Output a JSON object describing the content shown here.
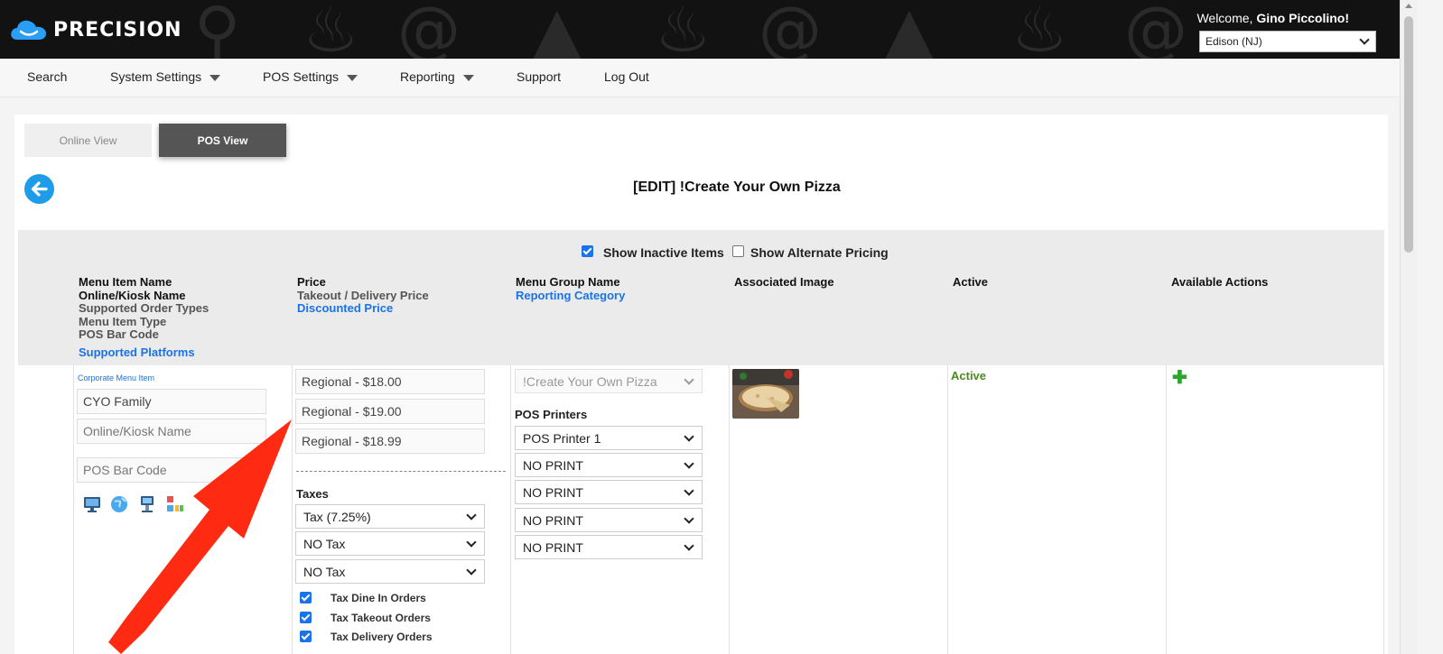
{
  "header": {
    "brand": "PRECISION",
    "welcome_prefix": "Welcome, ",
    "user_name": "Gino Piccolino!",
    "location": "Edison (NJ)"
  },
  "nav": {
    "search": "Search",
    "system_settings": "System Settings",
    "pos_settings": "POS Settings",
    "reporting": "Reporting",
    "support": "Support",
    "logout": "Log Out"
  },
  "tabs": {
    "online": "Online View",
    "pos": "POS View"
  },
  "page_title": "[EDIT] !Create Your Own Pizza",
  "filters": {
    "show_inactive": {
      "label": "Show Inactive Items",
      "checked": true
    },
    "show_alternate": {
      "label": "Show Alternate Pricing",
      "checked": false
    }
  },
  "columns": {
    "name": {
      "line1": "Menu Item Name",
      "line2": "Online/Kiosk Name",
      "line3": "Supported Order Types",
      "line4": "Menu Item Type",
      "line5": "POS Bar Code",
      "line6": "Supported Platforms"
    },
    "price": {
      "line1": "Price",
      "line2": "Takeout / Delivery Price",
      "line3": "Discounted Price"
    },
    "group": {
      "line1": "Menu Group Name",
      "line2": "Reporting Category"
    },
    "image": "Associated Image",
    "active": "Active",
    "actions": "Available Actions"
  },
  "row": {
    "corporate_link": "Corporate Menu Item",
    "name_value": "CYO Family",
    "online_name_placeholder": "Online/Kiosk Name",
    "barcode_placeholder": "POS Bar Code",
    "platform_icons": [
      "desktop-icon",
      "globe-icon",
      "kiosk-icon",
      "apps-icon"
    ],
    "prices": [
      "Regional - $18.00",
      "Regional - $19.00",
      "Regional - $18.99"
    ],
    "taxes_label": "Taxes",
    "taxes": [
      "Tax (7.25%)",
      "NO Tax",
      "NO Tax"
    ],
    "tax_options": [
      {
        "label": "Tax Dine In Orders",
        "checked": true
      },
      {
        "label": "Tax Takeout Orders",
        "checked": true
      },
      {
        "label": "Tax Delivery Orders",
        "checked": true
      }
    ],
    "menu_group": "!Create Your Own Pizza",
    "printers_label": "POS Printers",
    "printers": [
      "POS Printer 1",
      "NO PRINT",
      "NO PRINT",
      "NO PRINT",
      "NO PRINT"
    ],
    "status": "Active",
    "action_icon": "plus-icon"
  },
  "colors": {
    "accent": "#1a73e8",
    "active": "#4a8a1e",
    "annotation_arrow": "#ff2a12"
  }
}
